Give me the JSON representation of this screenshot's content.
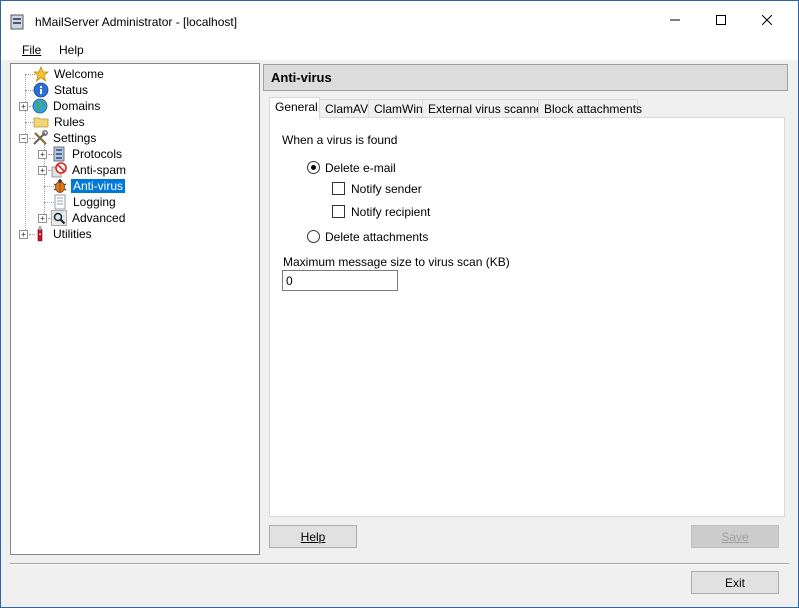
{
  "window": {
    "title": "hMailServer Administrator - [localhost]",
    "min_glyph": "—",
    "max_glyph": "☐",
    "close_glyph": "✕"
  },
  "menu": [
    {
      "label": "File"
    },
    {
      "label": "Help"
    }
  ],
  "tree": {
    "items": [
      {
        "label": "Welcome",
        "icon": "star-icon"
      },
      {
        "label": "Status",
        "icon": "info-icon"
      },
      {
        "label": "Domains",
        "icon": "globe-icon"
      },
      {
        "label": "Rules",
        "icon": "folder-icon"
      },
      {
        "label": "Settings",
        "icon": "tools-icon"
      },
      {
        "label": "Protocols",
        "icon": "server-icon"
      },
      {
        "label": "Anti-spam",
        "icon": "no-entry-icon"
      },
      {
        "label": "Anti-virus",
        "icon": "bug-icon"
      },
      {
        "label": "Logging",
        "icon": "document-icon"
      },
      {
        "label": "Advanced",
        "icon": "magnifier-icon"
      },
      {
        "label": "Utilities",
        "icon": "knife-icon"
      }
    ],
    "expand_plus": "+",
    "expand_minus": "−"
  },
  "panel": {
    "title": "Anti-virus"
  },
  "tabs": [
    {
      "label": "General"
    },
    {
      "label": "ClamAV"
    },
    {
      "label": "ClamWin"
    },
    {
      "label": "External virus scanner"
    },
    {
      "label": "Block attachments"
    }
  ],
  "general": {
    "section_label": "When a virus is found",
    "delete_email_label": "Delete e-mail",
    "notify_sender_label": "Notify sender",
    "notify_recipient_label": "Notify recipient",
    "delete_attachments_label": "Delete attachments",
    "max_size_label": "Maximum message size to virus scan (KB)",
    "max_size_value": "0"
  },
  "buttons": {
    "help": "Help",
    "save": "Save",
    "exit": "Exit"
  },
  "colors": {
    "selection": "#0078d7",
    "window_border": "#2b64a8"
  }
}
